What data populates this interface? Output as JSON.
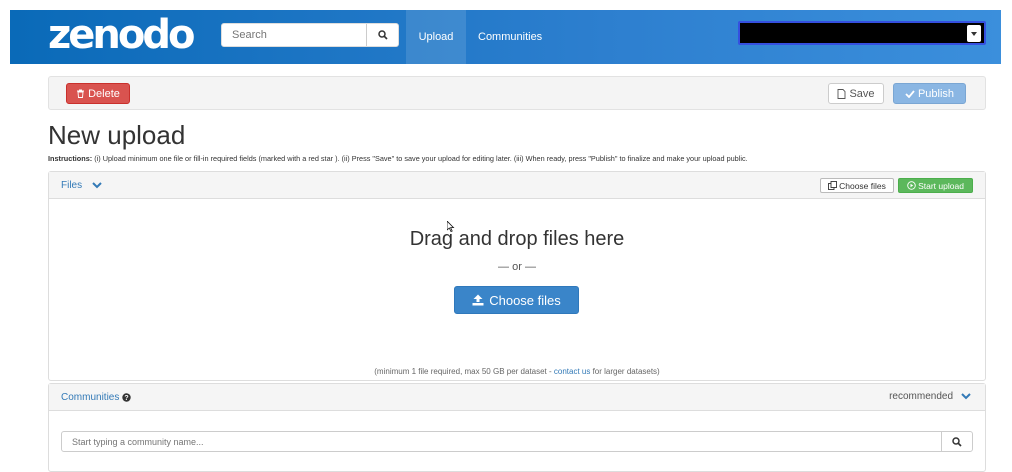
{
  "navbar": {
    "logo": "zenodo",
    "search_placeholder": "Search",
    "nav_upload": "Upload",
    "nav_communities": "Communities"
  },
  "toolbar": {
    "delete_label": "Delete",
    "save_label": "Save",
    "publish_label": "Publish"
  },
  "page": {
    "title": "New upload",
    "instructions_bold": "Instructions:",
    "instructions_text": " (i) Upload minimum one file or fill-in required fields (marked with a red star ). (ii) Press \"Save\" to save your upload for editing later. (iii) When ready, press \"Publish\" to finalize and make your upload public."
  },
  "files": {
    "heading": "Files",
    "choose_files_small": "Choose files",
    "start_upload": "Start upload",
    "drag_text": "Drag and drop files here",
    "or_text": "— or —",
    "choose_files_big": "Choose files",
    "note_prefix": "(minimum 1 file required, max 50 GB per dataset - ",
    "note_link": "contact us",
    "note_suffix": " for larger datasets)"
  },
  "communities": {
    "heading": "Communities",
    "recommended": "recommended",
    "input_placeholder": "Start typing a community name..."
  },
  "colors": {
    "navbar": "#0a6ab8",
    "delete": "#d9534f",
    "publish": "#8ab6e3",
    "start_upload": "#5cb85c",
    "choose_files": "#3a85c9",
    "link": "#337ab7"
  }
}
